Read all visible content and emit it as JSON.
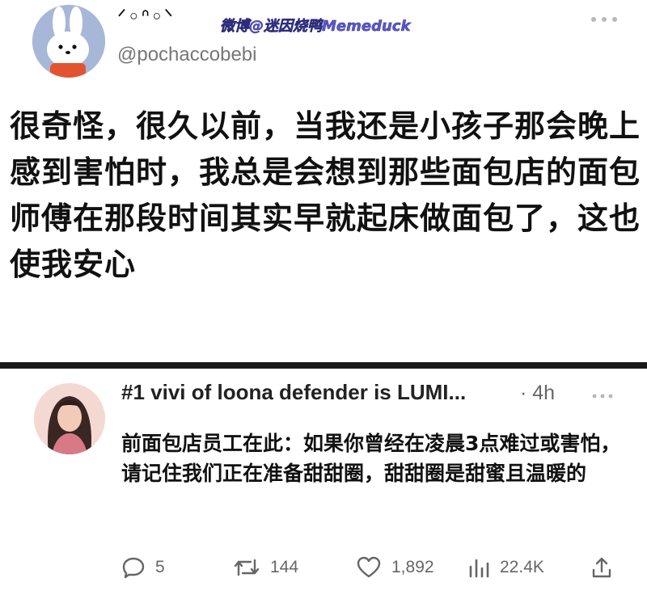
{
  "post": {
    "display_name": "ᐟ◦ᐢ◦ᐠ",
    "watermark": "微博@迷因烧鸭Memeduck",
    "handle": "@pochaccobebi",
    "more_icon": "more-horizontal-icon",
    "text": "很奇怪，很久以前，当我还是小孩子那会晚上感到害怕时，我总是会想到那些面包店的面包师傅在那段时间其实早就起床做面包了，这也使我安心"
  },
  "reply": {
    "name": "#1 vivi of loona defender is LUMI...",
    "meta": "· 4h",
    "text": "前面包店员工在此：如果你曾经在凌晨3点难过或害怕，请记住我们正在准备甜甜圈，甜甜圈是甜蜜且温暖的",
    "actions": {
      "reply_count": "5",
      "retweet_count": "144",
      "like_count": "1,892",
      "view_count": "22.4K"
    }
  },
  "colors": {
    "divider": "#1a1a1a",
    "muted": "#666666",
    "watermark": "#5b57d8"
  }
}
